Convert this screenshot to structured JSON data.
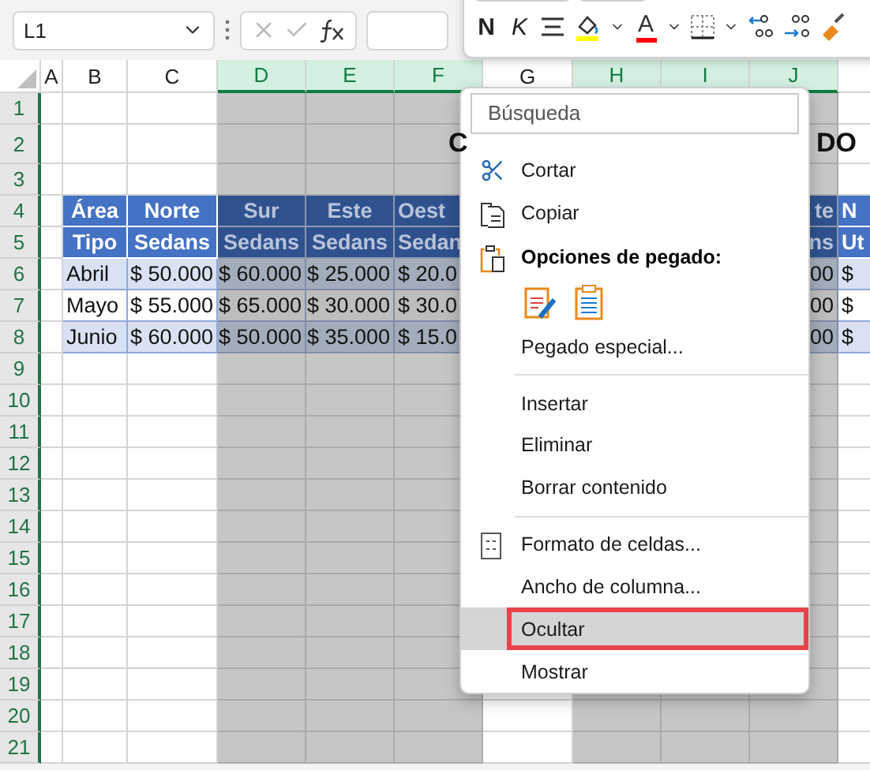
{
  "name_box": {
    "value": "L1"
  },
  "mini_toolbar": {
    "buttons": [
      {
        "kind": "bold",
        "label": "N"
      },
      {
        "kind": "italic",
        "label": "K"
      },
      {
        "kind": "align"
      },
      {
        "kind": "fill",
        "color": "#ffff00"
      },
      {
        "kind": "dropdown"
      },
      {
        "kind": "font_color",
        "label": "A",
        "color": "#ff0000"
      },
      {
        "kind": "dropdown"
      },
      {
        "kind": "borders"
      },
      {
        "kind": "dropdown"
      },
      {
        "kind": "decrease_decimals"
      },
      {
        "kind": "increase_decimals"
      },
      {
        "kind": "painter"
      }
    ]
  },
  "columns": [
    {
      "label": "A",
      "selected": false
    },
    {
      "label": "B",
      "selected": false
    },
    {
      "label": "C",
      "selected": false
    },
    {
      "label": "D",
      "selected": true
    },
    {
      "label": "E",
      "selected": true
    },
    {
      "label": "F",
      "selected": true
    },
    {
      "label": "G",
      "selected": false
    },
    {
      "label": "H",
      "selected": true
    },
    {
      "label": "I",
      "selected": true
    },
    {
      "label": "J",
      "selected": true
    }
  ],
  "rows": [
    "1",
    "2",
    "3",
    "4",
    "5",
    "6",
    "7",
    "8",
    "9",
    "10",
    "11",
    "12",
    "13",
    "14",
    "15",
    "16",
    "17",
    "18",
    "19",
    "20",
    "21"
  ],
  "title_fragments": [
    "C",
    "DO"
  ],
  "table": {
    "rows": [
      {
        "kind": "header",
        "cells": [
          "Área",
          "Norte",
          "Sur",
          "Este",
          "Oest",
          "te",
          "N"
        ]
      },
      {
        "kind": "header",
        "cells": [
          "Tipo",
          "Sedans",
          "Sedans",
          "Sedans",
          "Sedan",
          "ns",
          "Ut"
        ]
      },
      {
        "kind": "data",
        "banded": true,
        "cells": [
          "Abril",
          "$ 50.000",
          "$ 60.000",
          "$ 25.000",
          "$ 20.0",
          "00",
          "$"
        ]
      },
      {
        "kind": "data",
        "banded": false,
        "cells": [
          "Mayo",
          "$ 55.000",
          "$ 65.000",
          "$ 30.000",
          "$ 30.0",
          "00",
          "$"
        ]
      },
      {
        "kind": "data",
        "banded": true,
        "cells": [
          "Junio",
          "$ 60.000",
          "$ 50.000",
          "$ 35.000",
          "$ 15.0",
          "00",
          "$"
        ]
      }
    ]
  },
  "context_menu": {
    "search": {
      "placeholder": "Búsqueda"
    },
    "items": [
      {
        "kind": "cut",
        "label": "Cortar",
        "selected": false,
        "annotated": false
      },
      {
        "kind": "copy",
        "label": "Copiar",
        "selected": false,
        "annotated": false
      },
      {
        "kind": "heading",
        "label": "Opciones de pegado:"
      },
      {
        "kind": "paste_options"
      },
      {
        "kind": "plain",
        "label": "Pegado especial...",
        "selected": false,
        "annotated": false
      },
      {
        "kind": "separator"
      },
      {
        "kind": "plain",
        "label": "Insertar",
        "selected": false,
        "annotated": false
      },
      {
        "kind": "plain",
        "label": "Eliminar",
        "selected": false,
        "annotated": false
      },
      {
        "kind": "plain",
        "label": "Borrar contenido",
        "selected": false,
        "annotated": false
      },
      {
        "kind": "separator"
      },
      {
        "kind": "format",
        "label": "Formato de celdas...",
        "selected": false,
        "annotated": false
      },
      {
        "kind": "plain",
        "label": "Ancho de columna...",
        "selected": false,
        "annotated": false
      },
      {
        "kind": "plain",
        "label": "Ocultar",
        "selected": true,
        "annotated": true
      },
      {
        "kind": "plain",
        "label": "Mostrar",
        "selected": false,
        "annotated": false
      }
    ]
  }
}
